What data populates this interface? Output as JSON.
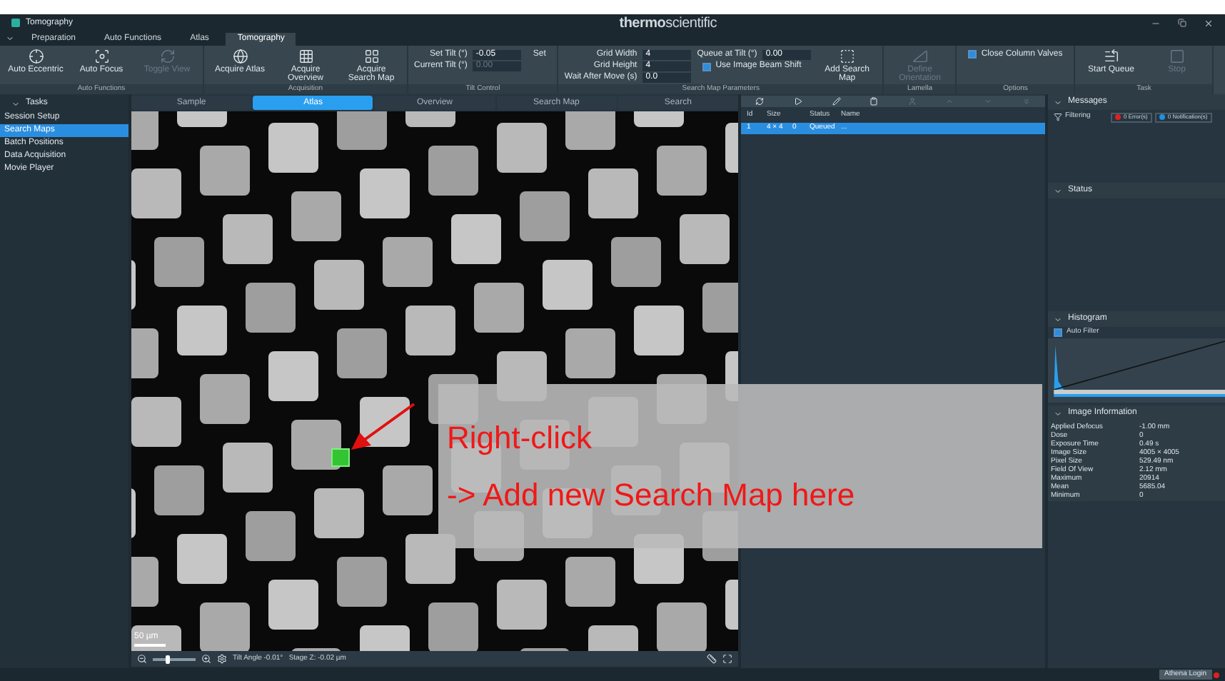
{
  "window": {
    "title": "Tomography",
    "brand": "**thermo**scientific"
  },
  "menu_tabs": [
    {
      "label": "Preparation",
      "selected": false
    },
    {
      "label": "Auto Functions",
      "selected": false
    },
    {
      "label": "Atlas",
      "selected": false
    },
    {
      "label": "Tomography",
      "selected": true
    }
  ],
  "ribbon": [
    {
      "label": "Auto Functions",
      "items": [
        {
          "kind": "button",
          "label": "Auto Eccentric",
          "disabled": false
        },
        {
          "kind": "button",
          "label": "Auto Focus",
          "disabled": false
        },
        {
          "kind": "button",
          "label": "Toggle View",
          "disabled": true
        }
      ]
    },
    {
      "label": "Acquisition",
      "items": [
        {
          "kind": "button",
          "label": "Acquire Atlas",
          "disabled": false
        },
        {
          "kind": "button",
          "label": "Acquire Overview",
          "disabled": false
        },
        {
          "kind": "button",
          "label": "Acquire Search Map",
          "disabled": false
        }
      ]
    },
    {
      "label": "Tilt Control",
      "items": [
        {
          "kind": "field",
          "label": "Set Tilt (°)",
          "value": "-0.05",
          "disabled": false
        },
        {
          "kind": "field",
          "label": "Current Tilt (°)",
          "value": "0.00",
          "disabled": true
        },
        {
          "kind": "small_button",
          "label": "Set",
          "disabled": false
        }
      ]
    },
    {
      "label": "Search Map Parameters",
      "items": [
        {
          "kind": "field",
          "label": "Grid Width",
          "value": "4",
          "disabled": false
        },
        {
          "kind": "field",
          "label": "Grid Height",
          "value": "4",
          "disabled": false
        },
        {
          "kind": "field",
          "label": "Wait After Move (s)",
          "value": "0.0",
          "disabled": false
        },
        {
          "kind": "field",
          "label": "Queue at Tilt (°)",
          "value": "0.00",
          "disabled": false
        },
        {
          "kind": "checkbox",
          "label": "Use Image Beam Shift",
          "checked": true
        },
        {
          "kind": "button",
          "label": "Add Search Map",
          "disabled": false
        }
      ]
    },
    {
      "label": "Lamella",
      "items": [
        {
          "kind": "button",
          "label": "Define Orientation",
          "disabled": true
        }
      ]
    },
    {
      "label": "Options",
      "items": [
        {
          "kind": "checkbox",
          "label": "Close Column Valves",
          "checked": true
        }
      ]
    },
    {
      "label": "Task",
      "items": [
        {
          "kind": "button",
          "label": "Start Queue",
          "disabled": false
        },
        {
          "kind": "button",
          "label": "Stop",
          "disabled": true
        }
      ]
    }
  ],
  "sidebar": {
    "title": "Tasks",
    "items": [
      {
        "label": "Session Setup",
        "selected": false
      },
      {
        "label": "Search Maps",
        "selected": true
      },
      {
        "label": "Batch Positions",
        "selected": false
      },
      {
        "label": "Data Acquisition",
        "selected": false
      },
      {
        "label": "Movie Player",
        "selected": false
      }
    ]
  },
  "steps": [
    {
      "label": "Sample",
      "selected": false
    },
    {
      "label": "Atlas",
      "selected": true
    },
    {
      "label": "Overview",
      "selected": false
    },
    {
      "label": "Search Map",
      "selected": false
    },
    {
      "label": "Search",
      "selected": false
    }
  ],
  "image": {
    "zoom": {
      "level": 0.35
    },
    "scale_bar": "50 µm",
    "status": "Tilt Angle -0.01°   Stage Z: -0.02 µm"
  },
  "annotation": {
    "lines": [
      "Right-click",
      "-> Add new Search Map here"
    ]
  },
  "queue": {
    "toolbar": [
      {
        "disabled": false
      },
      {
        "disabled": false
      },
      {
        "disabled": false
      },
      {
        "disabled": false
      },
      {
        "disabled": true
      },
      {
        "disabled": true
      },
      {
        "disabled": true
      },
      {
        "disabled": true
      }
    ],
    "columns": [
      "Id",
      "Size",
      "",
      "Status",
      "Name"
    ],
    "rows": [
      {
        "cells": [
          "1",
          "4 × 4",
          "0",
          "Queued",
          "..."
        ],
        "selected": true
      }
    ]
  },
  "messages": {
    "title": "Messages",
    "filter_label": "Filtering",
    "filters": [
      {
        "label": "0 Error(s)",
        "color": "#e02020"
      },
      {
        "label": "0 Notification(s)",
        "color": "#2090e0"
      }
    ]
  },
  "status_panel": {
    "title": "Status"
  },
  "histogram": {
    "title": "Histogram",
    "auto_filter": {
      "label": "Auto Filter",
      "checked": true
    }
  },
  "image_information": {
    "title": "Image Information",
    "rows": [
      [
        "Applied Defocus",
        "-1.00 mm"
      ],
      [
        "Dose",
        "0"
      ],
      [
        "Exposure Time",
        "0.49 s"
      ],
      [
        "Image Size",
        "4005 × 4005"
      ],
      [
        "Pixel Size",
        "529.49 nm"
      ],
      [
        "Field Of View",
        "2.12 mm"
      ],
      [
        "Maximum",
        "20914"
      ],
      [
        "Mean",
        "5685.04"
      ],
      [
        "Minimum",
        "0"
      ]
    ]
  },
  "status_bar": {
    "login": "Athena Login"
  }
}
